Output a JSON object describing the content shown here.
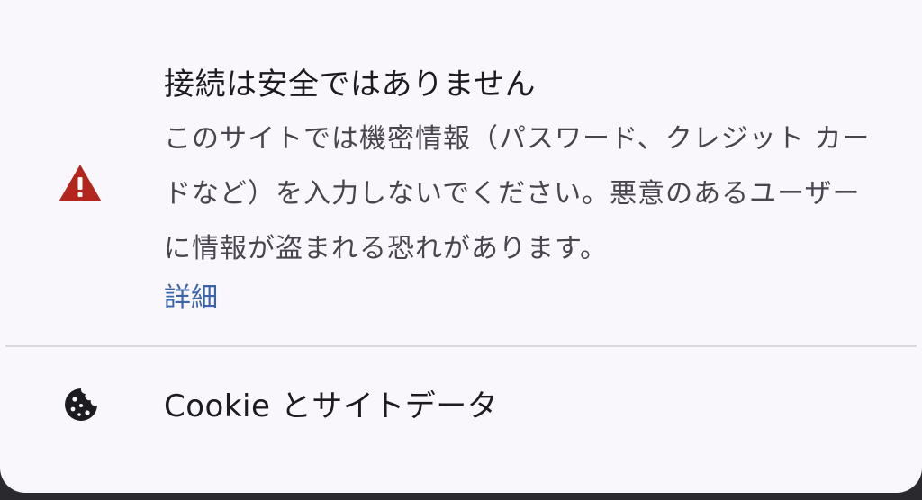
{
  "connection": {
    "title": "接続は安全ではありません",
    "description": "このサイトでは機密情報（パスワード、クレジット カードなど）を入力しないでください。悪意のあるユーザーに情報が盗まれる恐れがあります。",
    "details_link": "詳細",
    "icon": "warning-triangle",
    "icon_color": "#b3261e"
  },
  "cookies": {
    "label": "Cookie とサイトデータ",
    "icon": "cookie"
  },
  "colors": {
    "background": "#f9f7fc",
    "link": "#3b64a8",
    "warning": "#b3261e"
  }
}
